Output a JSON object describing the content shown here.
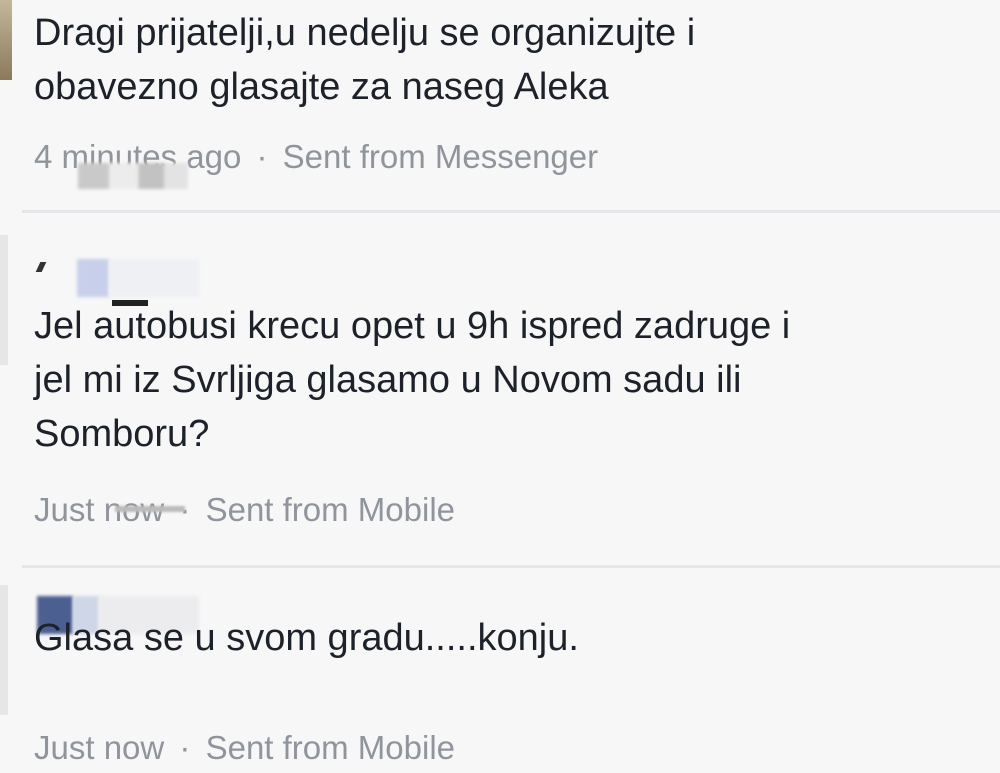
{
  "comments": [
    {
      "text_line1": "Dragi prijatelji,u nedelju se organizujte i",
      "text_line2": "obavezno glasajte za naseg Aleka",
      "time": "4 minutes ago",
      "separator": "·",
      "source": "Sent from Messenger"
    },
    {
      "text_line1": "Jel autobusi krecu opet u 9h ispred zadruge i",
      "text_line2": "jel mi iz Svrljiga glasamo u Novom sadu ili",
      "text_line3": "Somboru?",
      "time": "Just now",
      "separator": "·",
      "source": "Sent from Mobile"
    },
    {
      "text_line1": "Glasa se u svom gradu.....konju.",
      "time": "Just now",
      "separator": "·",
      "source": "Sent from Mobile"
    }
  ]
}
